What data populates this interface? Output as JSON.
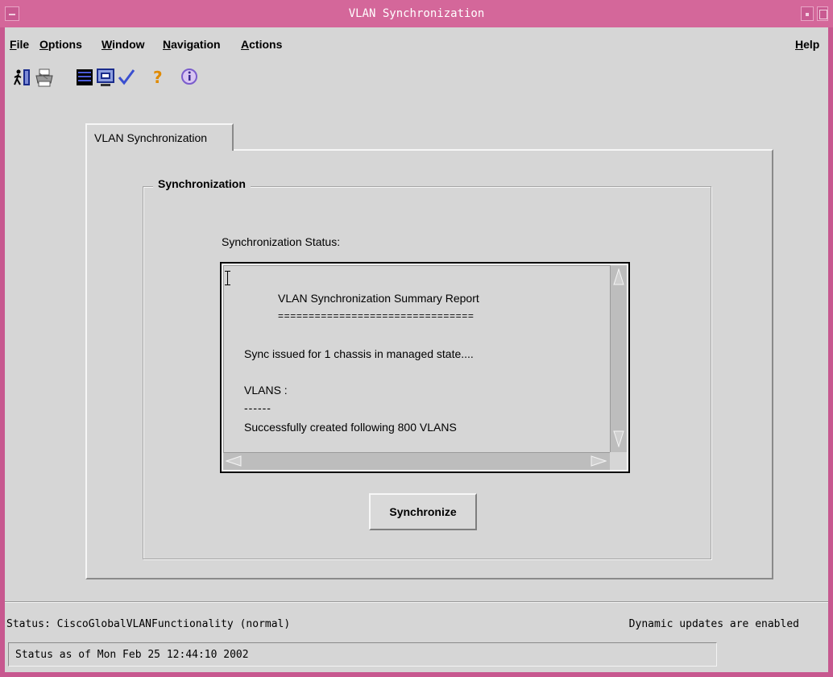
{
  "window": {
    "title": "VLAN Synchronization"
  },
  "menu": {
    "file": "File",
    "options": "Options",
    "window": "Window",
    "navigation": "Navigation",
    "actions": "Actions",
    "help": "Help"
  },
  "toolbar": {
    "icons": [
      "exit-icon",
      "print-icon",
      "list-icon",
      "monitor-icon",
      "checkmark-icon",
      "help-icon",
      "info-icon"
    ]
  },
  "tab": {
    "label": "VLAN Synchronization"
  },
  "group": {
    "label": "Synchronization"
  },
  "sync": {
    "status_label": "Synchronization Status:",
    "report_lines": [
      "VLAN Synchronization Summary Report",
      "================================",
      "Sync issued for 1 chassis in managed state....",
      "VLANS :",
      "------",
      "Successfully created following 800 VLANS"
    ],
    "button_label": "Synchronize"
  },
  "statusbar": {
    "status": "Status: CiscoGlobalVLANFunctionality (normal)",
    "dynamic": "Dynamic updates are enabled",
    "timestamp": "Status as of Mon Feb 25 12:44:10 2002"
  },
  "colors": {
    "titlebar": "#d4679a",
    "frame": "#c7588f",
    "background": "#d6d6d6"
  }
}
